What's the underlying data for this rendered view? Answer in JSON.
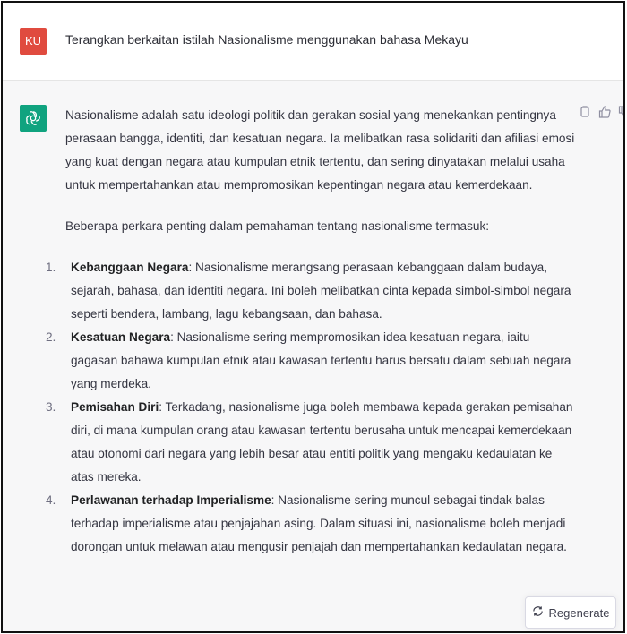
{
  "user": {
    "avatar": "KU",
    "message": "Terangkan berkaitan istilah Nasionalisme menggunakan bahasa Mekayu"
  },
  "assistant": {
    "avatar_icon": "chatgpt-logo-icon",
    "intro": "Nasionalisme adalah satu ideologi politik dan gerakan sosial yang menekankan pentingnya perasaan bangga, identiti, dan kesatuan negara. Ia melibatkan rasa solidariti dan afiliasi emosi yang kuat dengan negara atau kumpulan etnik tertentu, dan sering dinyatakan melalui usaha untuk mempertahankan atau mempromosikan kepentingan negara atau kemerdekaan.",
    "lead": "Beberapa perkara penting dalam pemahaman tentang nasionalisme termasuk:",
    "items": [
      {
        "num": "1.",
        "title": "Kebanggaan Negara",
        "text": ": Nasionalisme merangsang perasaan kebanggaan dalam budaya, sejarah, bahasa, dan identiti negara. Ini boleh melibatkan cinta kepada simbol-simbol negara seperti bendera, lambang, lagu kebangsaan, dan bahasa."
      },
      {
        "num": "2.",
        "title": "Kesatuan Negara",
        "text": ": Nasionalisme sering mempromosikan idea kesatuan negara, iaitu gagasan bahawa kumpulan etnik atau kawasan tertentu harus bersatu dalam sebuah negara yang merdeka."
      },
      {
        "num": "3.",
        "title": "Pemisahan Diri",
        "text": ": Terkadang, nasionalisme juga boleh membawa kepada gerakan pemisahan diri, di mana kumpulan orang atau kawasan tertentu berusaha untuk mencapai kemerdekaan atau otonomi dari negara yang lebih besar atau entiti politik yang mengaku kedaulatan ke atas mereka."
      },
      {
        "num": "4.",
        "title": "Perlawanan terhadap Imperialisme",
        "text": ": Nasionalisme sering muncul sebagai tindak balas terhadap imperialisme atau penjajahan asing. Dalam situasi ini, nasionalisme boleh menjadi dorongan untuk melawan atau mengusir penjajah dan mempertahankan kedaulatan negara."
      }
    ]
  },
  "actions": [
    "copy-icon",
    "thumbs-up-icon",
    "thumbs-down-icon"
  ],
  "regenerate": {
    "label": "Regenerate",
    "icon": "refresh-icon"
  },
  "colors": {
    "user_avatar": "#e04b3f",
    "bot_avatar": "#10a37f",
    "bot_bg": "#f7f7f8"
  }
}
